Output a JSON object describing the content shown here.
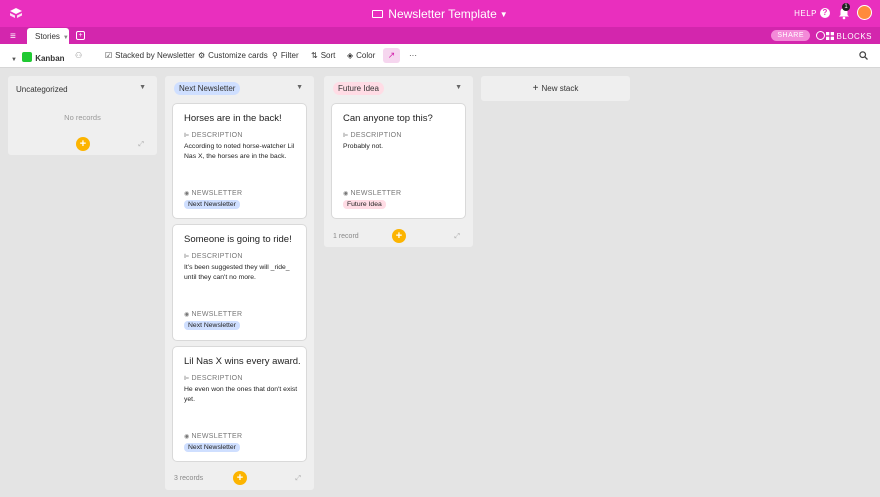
{
  "app": {
    "title": "Newsletter Template",
    "help_label": "HELP",
    "help_icon": "?",
    "notification_count": "1",
    "share_label": "SHARE",
    "blocks_label": "BLOCKS",
    "brand_color": "#e92fbe"
  },
  "tabs": {
    "active": "Stories",
    "add_symbol": "+"
  },
  "toolbar": {
    "view_name": "Kanban",
    "stacked_by": "Stacked by Newsletter",
    "customize": "Customize cards",
    "filter": "Filter",
    "sort": "Sort",
    "color": "Color",
    "more": "···"
  },
  "stacks": [
    {
      "name": "Uncategorized",
      "empty_text": "No records",
      "cards": []
    },
    {
      "name": "Next Newsletter",
      "color": "#cfdfff",
      "count_text": "3 records",
      "cards": [
        {
          "title": "Horses are in the back!",
          "description_label": "DESCRIPTION",
          "description": "According to noted horse-watcher Lil Nas X, the horses are in the back.",
          "newsletter_label": "NEWSLETTER",
          "newsletter": "Next Newsletter"
        },
        {
          "title": "Someone is going to ride!",
          "description_label": "DESCRIPTION",
          "description": "It's been suggested they will _ride_ until they can't no more.",
          "newsletter_label": "NEWSLETTER",
          "newsletter": "Next Newsletter"
        },
        {
          "title": "Lil Nas X wins every award.",
          "description_label": "DESCRIPTION",
          "description": "He even won the ones that don't exist yet.",
          "newsletter_label": "NEWSLETTER",
          "newsletter": "Next Newsletter"
        }
      ]
    },
    {
      "name": "Future Idea",
      "color": "#ffdce5",
      "count_text": "1 record",
      "cards": [
        {
          "title": "Can anyone top this?",
          "description_label": "DESCRIPTION",
          "description": "Probably not.",
          "newsletter_label": "NEWSLETTER",
          "newsletter": "Future Idea"
        }
      ]
    }
  ],
  "new_stack_label": "New stack",
  "add_symbol": "+"
}
